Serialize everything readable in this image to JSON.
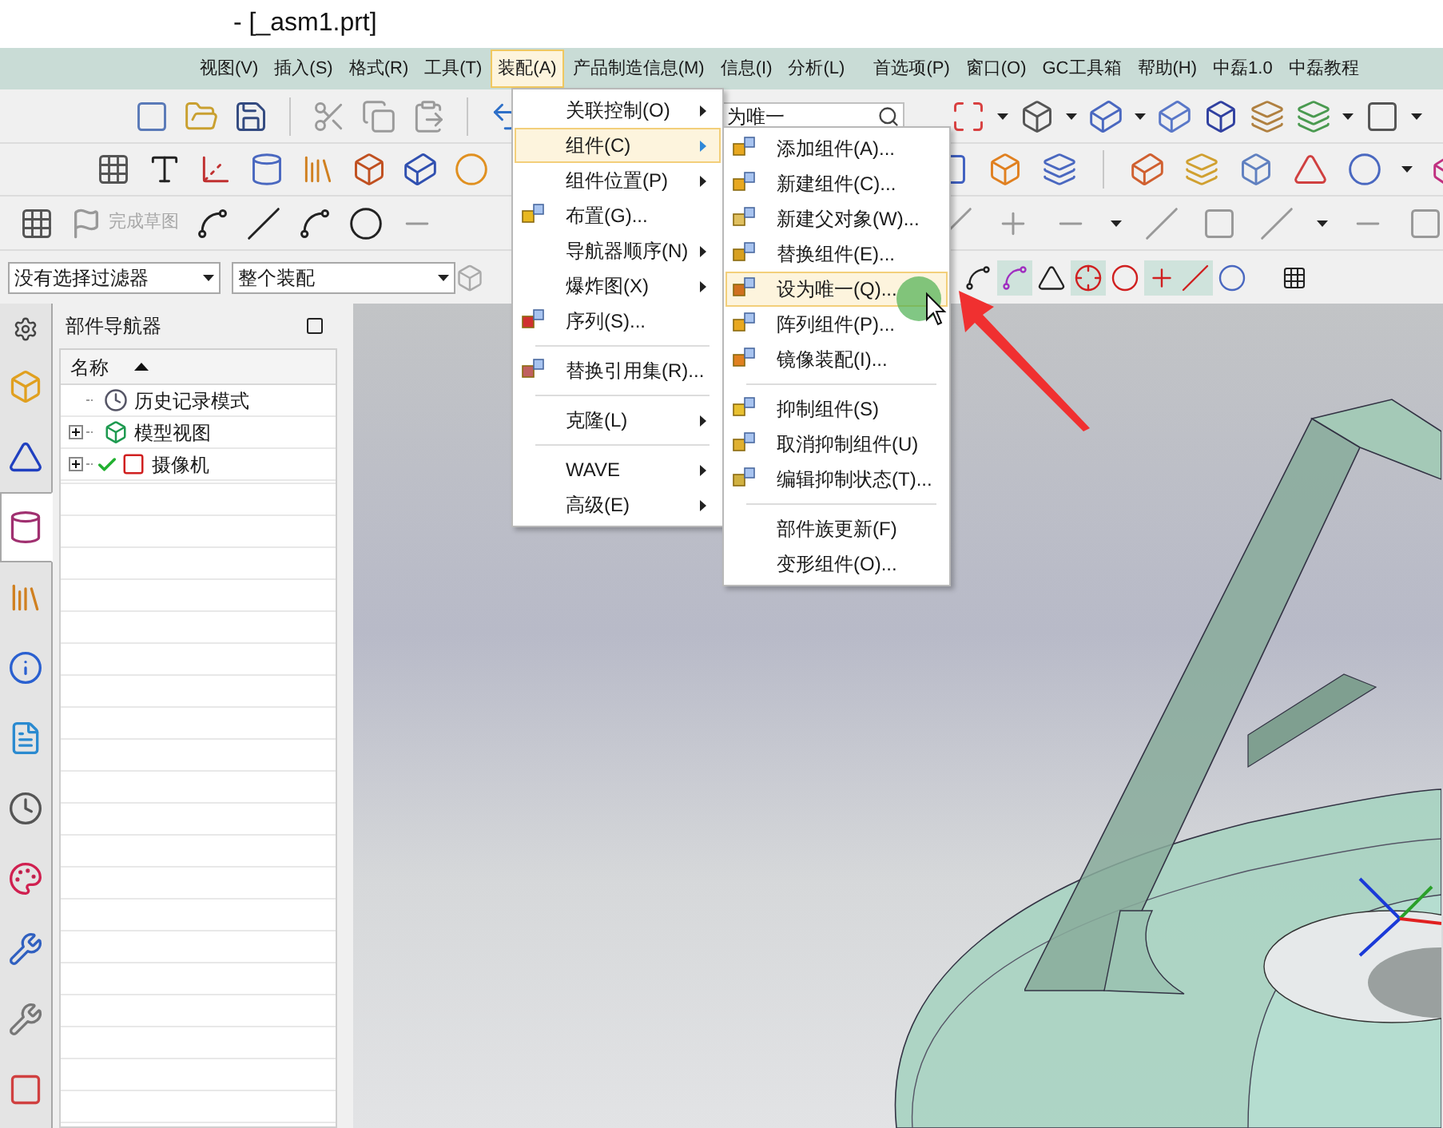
{
  "window": {
    "title": "- [_asm1.prt]"
  },
  "menu_bar": [
    {
      "label": "视图(V)",
      "selected": false
    },
    {
      "label": "插入(S)",
      "selected": false
    },
    {
      "label": "格式(R)",
      "selected": false
    },
    {
      "label": "工具(T)",
      "selected": false
    },
    {
      "label": "装配(A)",
      "selected": true
    },
    {
      "label": "产品制造信息(M)",
      "selected": false
    },
    {
      "label": "信息(I)",
      "selected": false
    },
    {
      "label": "分析(L)",
      "selected": false
    },
    {
      "label": "首选项(P)",
      "selected": false
    },
    {
      "label": "窗口(O)",
      "selected": false
    },
    {
      "label": "GC工具箱",
      "selected": false
    },
    {
      "label": "帮助(H)",
      "selected": false
    },
    {
      "label": "中磊1.0",
      "selected": false
    },
    {
      "label": "中磊教程",
      "selected": false
    }
  ],
  "command_search": {
    "value": "为唯一"
  },
  "sketch_toolbar": {
    "finish_label": "完成草图",
    "disabled": true
  },
  "filters": [
    {
      "value": "没有选择过滤器"
    },
    {
      "value": "整个装配"
    }
  ],
  "resource_tabs": [
    {
      "selected": false
    },
    {
      "selected": false
    },
    {
      "selected": false
    },
    {
      "selected": true
    },
    {
      "selected": false
    },
    {
      "selected": false
    },
    {
      "selected": false
    },
    {
      "selected": false
    },
    {
      "selected": false
    },
    {
      "selected": false
    },
    {
      "selected": false
    },
    {
      "selected": false
    }
  ],
  "part_navigator": {
    "title": "部件导航器",
    "column": "名称",
    "rows": [
      {
        "label": "历史记录模式",
        "kind": "mode",
        "expanded": false,
        "checked": false
      },
      {
        "label": "模型视图",
        "kind": "node",
        "expanded": false,
        "checked": false
      },
      {
        "label": "摄像机",
        "kind": "node",
        "expanded": false,
        "checked": true
      }
    ]
  },
  "assembly_menu": [
    {
      "kind": "submenu",
      "label": "关联控制(O)",
      "selected": false
    },
    {
      "kind": "submenu",
      "label": "组件(C)",
      "selected": true
    },
    {
      "kind": "submenu",
      "label": "组件位置(P)",
      "selected": false
    },
    {
      "kind": "command",
      "label": "布置(G)...",
      "selected": false
    },
    {
      "kind": "submenu",
      "label": "导航器顺序(N)",
      "selected": false
    },
    {
      "kind": "submenu",
      "label": "爆炸图(X)",
      "selected": false
    },
    {
      "kind": "command",
      "label": "序列(S)...",
      "selected": false
    },
    {
      "kind": "separator"
    },
    {
      "kind": "command",
      "label": "替换引用集(R)...",
      "selected": false
    },
    {
      "kind": "separator"
    },
    {
      "kind": "submenu",
      "label": "克隆(L)",
      "selected": false
    },
    {
      "kind": "separator"
    },
    {
      "kind": "submenu",
      "label": "WAVE",
      "selected": false
    },
    {
      "kind": "submenu",
      "label": "高级(E)",
      "selected": false
    }
  ],
  "component_submenu": [
    {
      "kind": "command",
      "label": "添加组件(A)...",
      "selected": false
    },
    {
      "kind": "command",
      "label": "新建组件(C)...",
      "selected": false
    },
    {
      "kind": "command",
      "label": "新建父对象(W)...",
      "selected": false
    },
    {
      "kind": "command",
      "label": "替换组件(E)...",
      "selected": false
    },
    {
      "kind": "command",
      "label": "设为唯一(Q)...",
      "selected": true
    },
    {
      "kind": "command",
      "label": "阵列组件(P)...",
      "selected": false
    },
    {
      "kind": "command",
      "label": "镜像装配(I)...",
      "selected": false
    },
    {
      "kind": "separator"
    },
    {
      "kind": "command",
      "label": "抑制组件(S)",
      "selected": false
    },
    {
      "kind": "command",
      "label": "取消抑制组件(U)",
      "selected": false
    },
    {
      "kind": "command",
      "label": "编辑抑制状态(T)...",
      "selected": false
    },
    {
      "kind": "separator"
    },
    {
      "kind": "command",
      "label": "部件族更新(F)",
      "selected": false
    },
    {
      "kind": "command",
      "label": "变形组件(O)...",
      "selected": false
    }
  ]
}
